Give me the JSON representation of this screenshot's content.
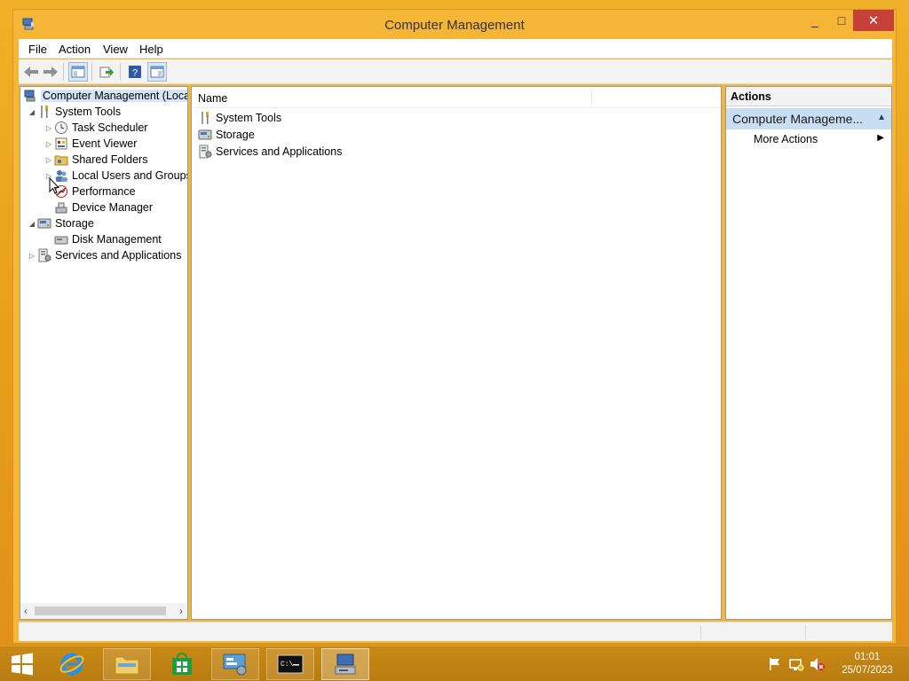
{
  "window": {
    "title": "Computer Management",
    "controls": {
      "minimize": "_",
      "maximize": "□",
      "close": "✕"
    }
  },
  "menu": {
    "items": [
      "File",
      "Action",
      "View",
      "Help"
    ]
  },
  "toolbar": {
    "buttons": [
      "back-icon",
      "forward-icon",
      "show-hide-console-tree-icon",
      "export-list-icon",
      "help-icon",
      "show-hide-action-pane-icon"
    ]
  },
  "tree": {
    "root": "Computer Management (Local",
    "items": [
      {
        "label": "System Tools",
        "arrow": "◢",
        "icon": "tools-icon"
      },
      {
        "label": "Task Scheduler",
        "arrow": "▷",
        "icon": "clock-icon"
      },
      {
        "label": "Event Viewer",
        "arrow": "▷",
        "icon": "event-viewer-icon"
      },
      {
        "label": "Shared Folders",
        "arrow": "▷",
        "icon": "shared-folder-icon"
      },
      {
        "label": "Local Users and Groups",
        "arrow": "▷",
        "icon": "users-icon"
      },
      {
        "label": "Performance",
        "arrow": "",
        "icon": "performance-icon"
      },
      {
        "label": "Device Manager",
        "arrow": "",
        "icon": "device-manager-icon"
      },
      {
        "label": "Storage",
        "arrow": "◢",
        "icon": "storage-icon"
      },
      {
        "label": "Disk Management",
        "arrow": "",
        "icon": "disk-icon"
      },
      {
        "label": "Services and Applications",
        "arrow": "▷",
        "icon": "services-icon"
      }
    ]
  },
  "list": {
    "column_name": "Name",
    "rows": [
      "System Tools",
      "Storage",
      "Services and Applications"
    ]
  },
  "actions": {
    "header": "Actions",
    "section": "Computer Manageme...",
    "items": [
      "More Actions"
    ]
  },
  "taskbar": {
    "apps": [
      "start-button",
      "internet-explorer-icon",
      "file-explorer-icon",
      "store-icon",
      "control-panel-icon",
      "command-prompt-icon",
      "computer-management-icon"
    ],
    "clock_time": "01:01",
    "clock_date": "25/07/2023"
  },
  "colors": {
    "accent": "#f5b638",
    "selection": "#c9ddf3",
    "close_button": "#c7403a",
    "taskbar": "#c08313"
  }
}
